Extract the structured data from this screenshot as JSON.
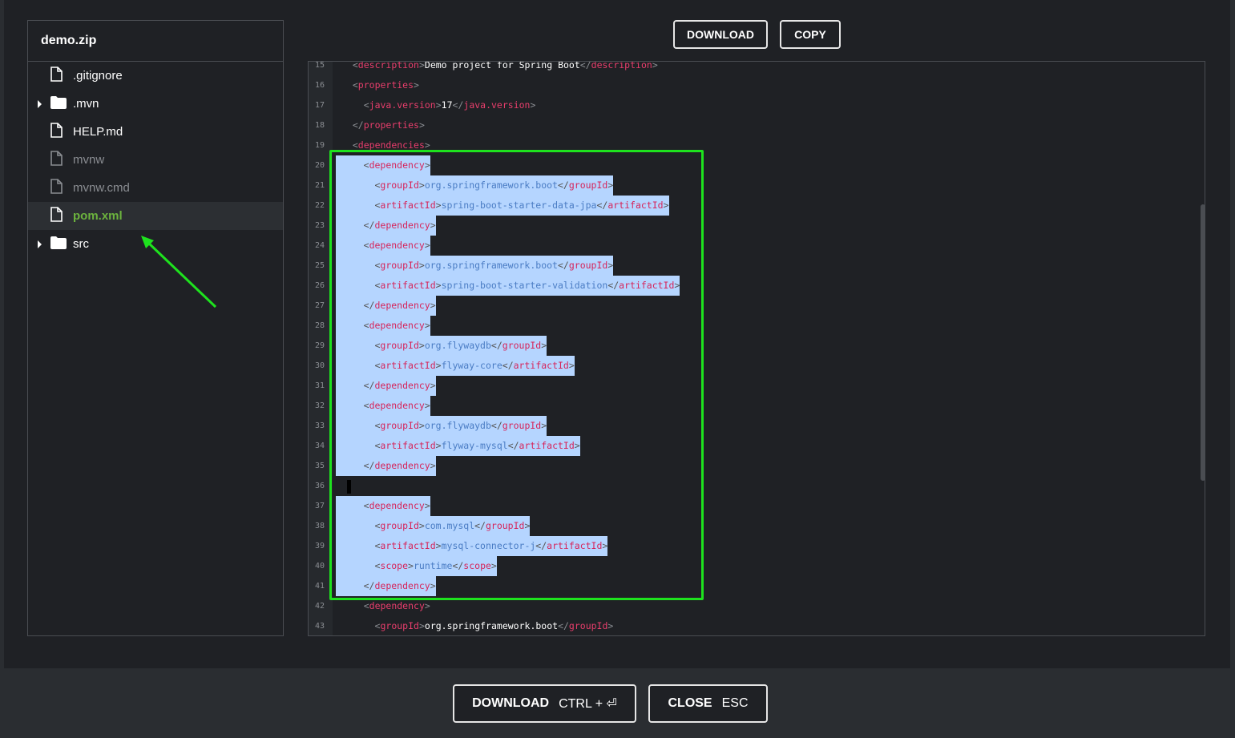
{
  "explorer": {
    "title": "demo.zip",
    "items": [
      {
        "label": ".gitignore",
        "icon": "file-icon",
        "folder": false,
        "dim": false,
        "selected": false
      },
      {
        "label": ".mvn",
        "icon": "folder-icon",
        "folder": true,
        "dim": false,
        "selected": false
      },
      {
        "label": "HELP.md",
        "icon": "file-icon",
        "folder": false,
        "dim": false,
        "selected": false
      },
      {
        "label": "mvnw",
        "icon": "file-icon",
        "folder": false,
        "dim": true,
        "selected": false
      },
      {
        "label": "mvnw.cmd",
        "icon": "file-icon",
        "folder": false,
        "dim": true,
        "selected": false
      },
      {
        "label": "pom.xml",
        "icon": "file-icon",
        "folder": false,
        "dim": false,
        "selected": true
      },
      {
        "label": "src",
        "icon": "folder-icon",
        "folder": true,
        "dim": false,
        "selected": false
      }
    ]
  },
  "toolbar": {
    "download_label": "DOWNLOAD",
    "copy_label": "COPY"
  },
  "code": {
    "lines": [
      {
        "n": "15",
        "indent": 2,
        "tag": "description",
        "text": "Demo project for Spring Boot",
        "sel": false
      },
      {
        "n": "16",
        "indent": 2,
        "tag": "properties",
        "open": true,
        "sel": false
      },
      {
        "n": "17",
        "indent": 4,
        "tag": "java.version",
        "text": "17",
        "sel": false
      },
      {
        "n": "18",
        "indent": 2,
        "tag": "properties",
        "close": true,
        "sel": false
      },
      {
        "n": "19",
        "indent": 2,
        "tag": "dependencies",
        "open": true,
        "sel": false
      },
      {
        "n": "20",
        "indent": 4,
        "tag": "dependency",
        "open": true,
        "sel": true
      },
      {
        "n": "21",
        "indent": 6,
        "tag": "groupId",
        "text": "org.springframework.boot",
        "sel": true
      },
      {
        "n": "22",
        "indent": 6,
        "tag": "artifactId",
        "text": "spring-boot-starter-data-jpa",
        "sel": true
      },
      {
        "n": "23",
        "indent": 4,
        "tag": "dependency",
        "close": true,
        "sel": true
      },
      {
        "n": "24",
        "indent": 4,
        "tag": "dependency",
        "open": true,
        "sel": true
      },
      {
        "n": "25",
        "indent": 6,
        "tag": "groupId",
        "text": "org.springframework.boot",
        "sel": true
      },
      {
        "n": "26",
        "indent": 6,
        "tag": "artifactId",
        "text": "spring-boot-starter-validation",
        "sel": true
      },
      {
        "n": "27",
        "indent": 4,
        "tag": "dependency",
        "close": true,
        "sel": true
      },
      {
        "n": "28",
        "indent": 4,
        "tag": "dependency",
        "open": true,
        "sel": true
      },
      {
        "n": "29",
        "indent": 6,
        "tag": "groupId",
        "text": "org.flywaydb",
        "sel": true
      },
      {
        "n": "30",
        "indent": 6,
        "tag": "artifactId",
        "text": "flyway-core",
        "sel": true
      },
      {
        "n": "31",
        "indent": 4,
        "tag": "dependency",
        "close": true,
        "sel": true
      },
      {
        "n": "32",
        "indent": 4,
        "tag": "dependency",
        "open": true,
        "sel": true
      },
      {
        "n": "33",
        "indent": 6,
        "tag": "groupId",
        "text": "org.flywaydb",
        "sel": true
      },
      {
        "n": "34",
        "indent": 6,
        "tag": "artifactId",
        "text": "flyway-mysql",
        "sel": true
      },
      {
        "n": "35",
        "indent": 4,
        "tag": "dependency",
        "close": true,
        "sel": true
      },
      {
        "n": "36",
        "blank": true,
        "sel": true
      },
      {
        "n": "37",
        "indent": 4,
        "tag": "dependency",
        "open": true,
        "sel": true
      },
      {
        "n": "38",
        "indent": 6,
        "tag": "groupId",
        "text": "com.mysql",
        "sel": true
      },
      {
        "n": "39",
        "indent": 6,
        "tag": "artifactId",
        "text": "mysql-connector-j",
        "sel": true
      },
      {
        "n": "40",
        "indent": 6,
        "tag": "scope",
        "text": "runtime",
        "sel": true
      },
      {
        "n": "41",
        "indent": 4,
        "tag": "dependency",
        "close": true,
        "sel": true
      },
      {
        "n": "42",
        "indent": 4,
        "tag": "dependency",
        "open": true,
        "sel": false
      },
      {
        "n": "43",
        "indent": 6,
        "tag": "groupId",
        "text": "org.springframework.boot",
        "sel": false
      }
    ]
  },
  "footer": {
    "download_label": "DOWNLOAD",
    "download_shortcut": "CTRL + ⏎",
    "close_label": "CLOSE",
    "close_shortcut": "ESC"
  },
  "colors": {
    "accent_green": "#6cb33e",
    "annotation_green": "#1ee21e",
    "tag_pink": "#e83e6c",
    "selection_blue": "#b5d5ff"
  }
}
